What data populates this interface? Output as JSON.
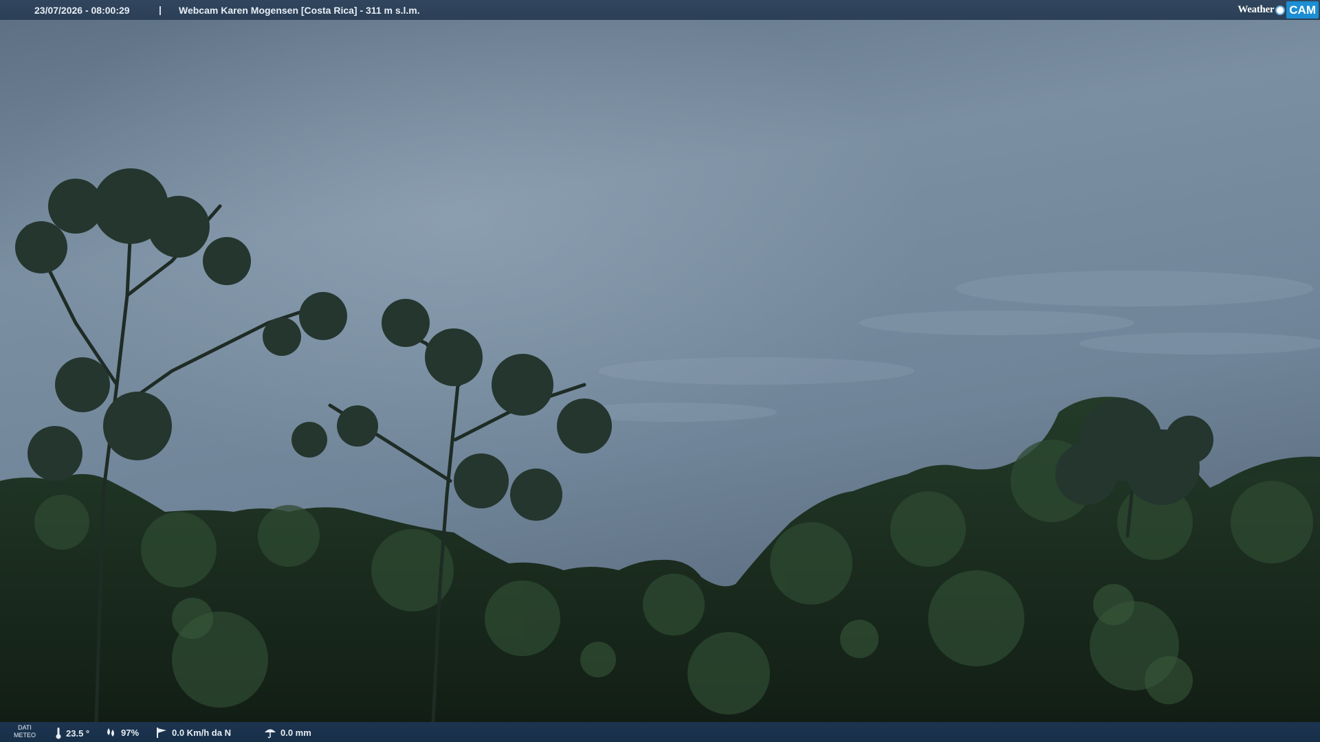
{
  "overlay_top": {
    "timestamp": "23/07/2026 - 08:00:29",
    "separator": "|",
    "title": "Webcam Karen Mogensen [Costa Rica]  - 311 m s.l.m."
  },
  "brand": {
    "weather": "Weather",
    "cam": "CAM"
  },
  "weather_bar": {
    "label_line1": "DATI",
    "label_line2": "METEO",
    "temperature": "23.5 °",
    "humidity": "97%",
    "wind": "0.0 Km/h da N",
    "rain": "0.0 mm",
    "icons": [
      "thermometer-icon",
      "humidity-drops-icon",
      "wind-flag-icon",
      "rain-umbrella-icon"
    ]
  },
  "colors": {
    "sky_top": "#5e7185",
    "sky_mid": "#7d91a4",
    "foliage_dark": "#16241a",
    "foliage_mid": "#253d29",
    "bar_top": "#2f4560",
    "bar_bottom": "#1a314b",
    "brand_blue": "#1c8ed3"
  }
}
